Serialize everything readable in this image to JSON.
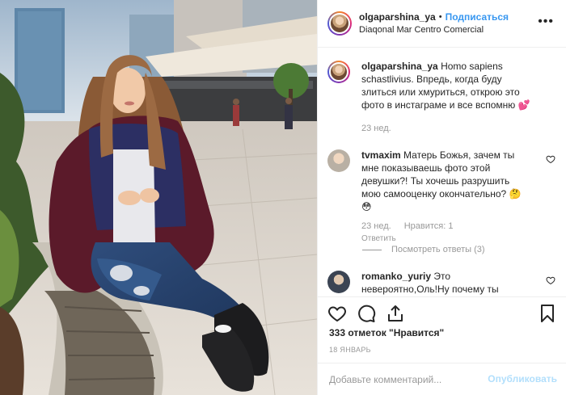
{
  "header": {
    "username": "olgaparshina_ya",
    "dot": "•",
    "follow_label": "Подписаться",
    "location": "Diaqonal Mar Centro Comercial",
    "more": "•••"
  },
  "caption": {
    "username": "olgaparshina_ya",
    "text": "Homo sapiens schastlivius. Впредь, когда буду злиться или хмуриться, открою это фото в инстаграме и все вспомню 💕",
    "time": "23 нед."
  },
  "comments": [
    {
      "username": "tvmaxim",
      "text": "Матерь Божья, зачем ты мне показываешь фото этой девушки?! Ты хочешь разрушить мою самооценку окончательно? 🤔😳",
      "time": "23 нед.",
      "likes": "Нравится: 1",
      "reply_label": "Ответить"
    },
    {
      "username": "romanko_yuriy",
      "text": "Это невероятно,Оль!Ну почему ты"
    }
  ],
  "view_replies": "Посмотреть ответы (3)",
  "likes_count": "333 отметок \"Нравится\"",
  "post_date": "18 ЯНВАРЬ",
  "add_comment": {
    "placeholder": "Добавьте комментарий...",
    "publish_label": "Опубликовать"
  },
  "colors": {
    "accent": "#3897f0",
    "publish_disabled": "#b2dffc",
    "secondary_text": "#999999"
  },
  "icons": [
    "heart-icon",
    "comment-icon",
    "share-icon",
    "bookmark-icon",
    "more-icon",
    "small-heart-icon"
  ]
}
